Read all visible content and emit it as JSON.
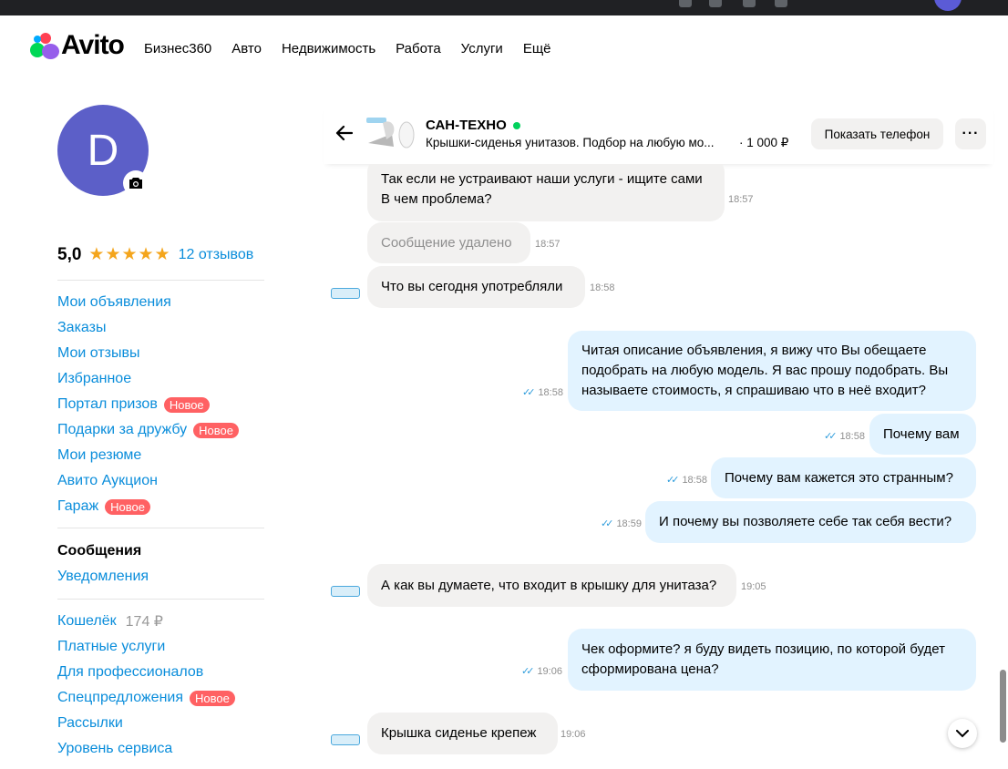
{
  "colors": {
    "link": "#0a8ddb",
    "badge": "#ff6163",
    "incoming_bubble": "#f2f1f0",
    "outgoing_bubble": "#e2f3ff",
    "online": "#02d15c",
    "avatar": "#5c5fc8"
  },
  "logo": {
    "text": "Avito"
  },
  "nav": [
    "Бизнес360",
    "Авто",
    "Недвижимость",
    "Работа",
    "Услуги",
    "Ещё"
  ],
  "profile": {
    "avatar_letter": "D",
    "rating": "5,0",
    "stars": "★★★★★",
    "reviews": "12 отзывов",
    "star_count": 5
  },
  "sidebar": {
    "group1": [
      {
        "label": "Мои объявления",
        "badge": null
      },
      {
        "label": "Заказы",
        "badge": null
      },
      {
        "label": "Мои отзывы",
        "badge": null
      },
      {
        "label": "Избранное",
        "badge": null
      },
      {
        "label": "Портал призов",
        "badge": "Новое"
      },
      {
        "label": "Подарки за дружбу",
        "badge": "Новое"
      },
      {
        "label": "Мои резюме",
        "badge": null
      },
      {
        "label": "Авито Аукцион",
        "badge": null
      },
      {
        "label": "Гараж",
        "badge": "Новое"
      }
    ],
    "group2": [
      {
        "label": "Сообщения"
      },
      {
        "label": "Уведомления"
      }
    ],
    "group3": [
      {
        "label": "Кошелёк",
        "extra": "174 ₽"
      },
      {
        "label": "Платные услуги"
      },
      {
        "label": "Для профессионалов"
      },
      {
        "label": "Спецпредложения",
        "badge": "Новое"
      },
      {
        "label": "Рассылки"
      },
      {
        "label": "Уровень сервиса"
      }
    ]
  },
  "chat": {
    "seller": "САН-ТЕХНО",
    "item_title": "Крышки-сиденья унитазов. Подбор на любую мо...",
    "item_price": "· 1 000 ₽",
    "phone_button": "Показать телефон",
    "more_button": "···"
  },
  "messages": [
    {
      "dir": "in",
      "lines": [
        "Так если не устраивают наши услуги - ищите сами",
        "В чем проблема?"
      ],
      "time": "18:57"
    },
    {
      "dir": "in",
      "lines": [
        "Сообщение удалено"
      ],
      "time": "18:57",
      "deleted": true
    },
    {
      "dir": "in",
      "lines": [
        "Что вы сегодня употребляли"
      ],
      "time": "18:58"
    },
    {
      "dir": "out",
      "lines": [
        "Читая описание объявления, я вижу что Вы обещаете",
        "подобрать на любую модель. Я вас прошу подобрать. Вы",
        "называете стоимость, я спрашиваю что в неё входит?"
      ],
      "time": "18:58"
    },
    {
      "dir": "out",
      "lines": [
        "Почему вам"
      ],
      "time": "18:58"
    },
    {
      "dir": "out",
      "lines": [
        "Почему вам кажется это странным?"
      ],
      "time": "18:58"
    },
    {
      "dir": "out",
      "lines": [
        "И почему вы позволяете себе так себя вести?"
      ],
      "time": "18:59"
    },
    {
      "dir": "in",
      "lines": [
        "А как вы думаете, что входит в крышку для унитаза?"
      ],
      "time": "19:05"
    },
    {
      "dir": "out",
      "lines": [
        "Чек оформите? я буду видеть позицию, по которой будет",
        "сформирована цена?"
      ],
      "time": "19:06"
    },
    {
      "dir": "in",
      "lines": [
        "Крышка сиденье крепеж"
      ],
      "time": "19:06"
    }
  ]
}
